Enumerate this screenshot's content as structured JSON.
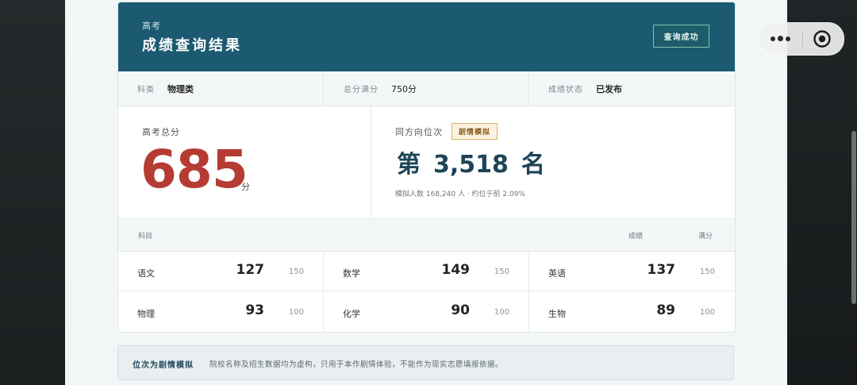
{
  "header": {
    "supertitle": "高考",
    "title": "成绩查询结果",
    "status_button": "查询成功"
  },
  "meta": {
    "items": [
      {
        "label": "科类",
        "value": "物理类"
      },
      {
        "label": "总分满分",
        "value": "750分"
      },
      {
        "label": "成绩状态",
        "value": "已发布"
      }
    ]
  },
  "score": {
    "label": "高考总分",
    "value": "685",
    "unit": "分"
  },
  "rank": {
    "label": "同方向位次",
    "badge": "剧情模拟",
    "prefix": "第",
    "value": "3,518",
    "suffix": "名",
    "note": "模拟人数 168,240 人 · 约位于前 2.09%"
  },
  "subjects": {
    "headers": {
      "subject": "科目",
      "score": "成绩",
      "full": "满分"
    },
    "rows": [
      {
        "name": "语文",
        "score": "127",
        "full": "150"
      },
      {
        "name": "数学",
        "score": "149",
        "full": "150"
      },
      {
        "name": "英语",
        "score": "137",
        "full": "150"
      },
      {
        "name": "物理",
        "score": "93",
        "full": "100"
      },
      {
        "name": "化学",
        "score": "90",
        "full": "100"
      },
      {
        "name": "生物",
        "score": "89",
        "full": "100"
      }
    ]
  },
  "footer": {
    "title": "位次为剧情模拟",
    "text": "院校名称及招生数据均为虚构，只用于本作剧情体验，不能作为现实志愿填报依据。"
  },
  "colors": {
    "header_bg": "#1c5a72",
    "score_red": "#b63b33",
    "rank_blue": "#1d4557",
    "badge_gold": "#d9b46c"
  }
}
